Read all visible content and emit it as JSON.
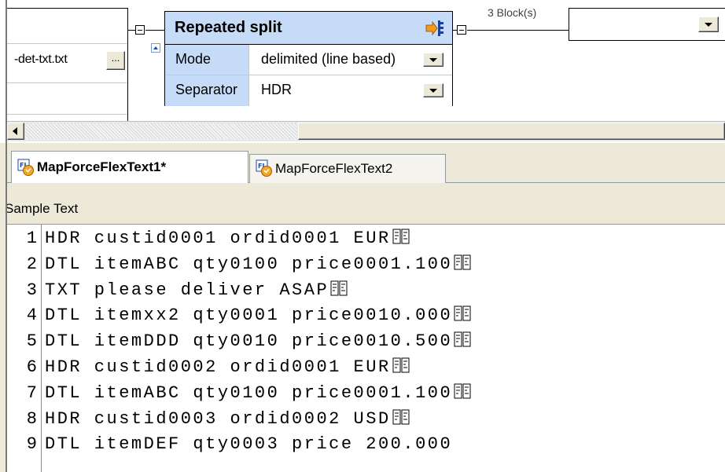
{
  "left_component": {
    "file_name": "-det-txt.txt",
    "browse_label": "..."
  },
  "repeated_split": {
    "title": "Repeated split",
    "rows": [
      {
        "label": "Mode",
        "value": "delimited (line based)"
      },
      {
        "label": "Separator",
        "value": "HDR"
      }
    ]
  },
  "connection": {
    "block_label": "3 Block(s)"
  },
  "tabs": [
    {
      "label": "MapForceFlexText1*",
      "active": true
    },
    {
      "label": "MapForceFlexText2",
      "active": false
    }
  ],
  "sample": {
    "header": "Sample Text",
    "lines": [
      {
        "num": "1",
        "text": "HDR custid0001 ordid0001 EUR",
        "crlf": true
      },
      {
        "num": "2",
        "text": "DTL itemABC qty0100 price0001.100",
        "crlf": true
      },
      {
        "num": "3",
        "text": "TXT please deliver ASAP",
        "crlf": true
      },
      {
        "num": "4",
        "text": "DTL itemxx2 qty0001 price0010.000",
        "crlf": true
      },
      {
        "num": "5",
        "text": "DTL itemDDD qty0010 price0010.500",
        "crlf": true
      },
      {
        "num": "6",
        "text": "HDR custid0002 ordid0001 EUR",
        "crlf": true
      },
      {
        "num": "7",
        "text": "DTL itemABC qty0100 price0001.100",
        "crlf": true
      },
      {
        "num": "8",
        "text": "HDR custid0003 ordid0002 USD",
        "crlf": true
      },
      {
        "num": "9",
        "text": "DTL itemDEF qty0003 price 200.000",
        "crlf": false
      }
    ]
  },
  "colors": {
    "component_header": "#c6dbf7",
    "background": "#ece9d8"
  }
}
